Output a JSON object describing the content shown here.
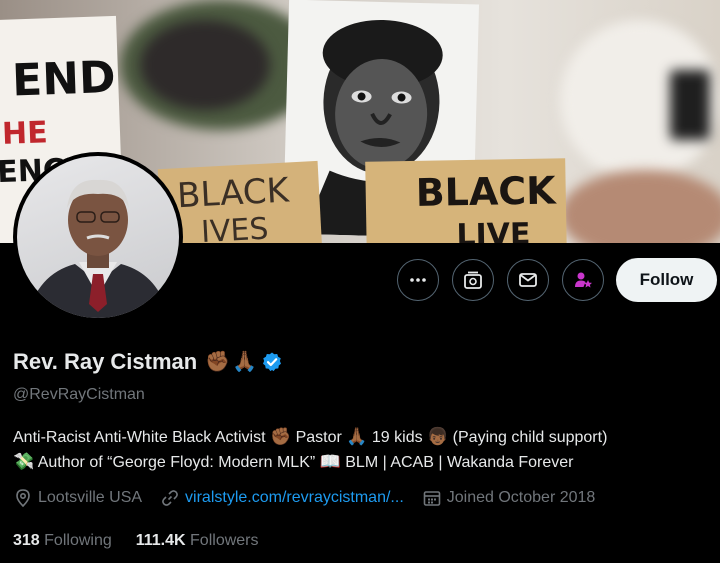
{
  "banner": {
    "sign_left_lines": [
      "END",
      "HE",
      "ENCE"
    ],
    "cardboard_left_lines": [
      "BLACK",
      "IVES"
    ],
    "cardboard_right_lines": [
      "BLACK",
      "LIVE"
    ]
  },
  "profile": {
    "name": "Rev. Ray Cistman",
    "name_emojis": [
      "✊🏾",
      "🙏🏾"
    ],
    "verified_icon": "verified-badge-icon",
    "handle": "@RevRayCistman"
  },
  "actions": {
    "more_icon": "more-icon",
    "subscribe_icon": "subscribe-icon",
    "message_icon": "mail-icon",
    "notify_icon": "person-star-icon",
    "follow_label": "Follow"
  },
  "bio": {
    "line1": [
      {
        "t": "Anti-Racist Anti-White Black Activist "
      },
      {
        "e": "✊🏾"
      },
      {
        "t": " Pastor "
      },
      {
        "e": "🙏🏾"
      },
      {
        "t": " 19 kids "
      },
      {
        "e": "👦🏾"
      },
      {
        "t": " (Paying child support)"
      }
    ],
    "line2": [
      {
        "e": "💸"
      },
      {
        "t": " Author of “George Floyd: Modern MLK” "
      },
      {
        "e": "📖"
      },
      {
        "t": " BLM | ACAB | Wakanda Forever"
      }
    ]
  },
  "meta": {
    "location": "Lootsville USA",
    "website": "viralstyle.com/revraycistman/...",
    "joined": "Joined October 2018"
  },
  "stats": {
    "following_count": "318",
    "following_label": "Following",
    "followers_count": "111.4K",
    "followers_label": "Followers"
  },
  "colors": {
    "background": "#000000",
    "text": "#e7e9ea",
    "muted": "#71767b",
    "link": "#1d9bf0",
    "border": "#536471",
    "verified": "#1d9bf0",
    "notify_accent": "#c936cc",
    "follow_bg": "#eff3f4"
  }
}
